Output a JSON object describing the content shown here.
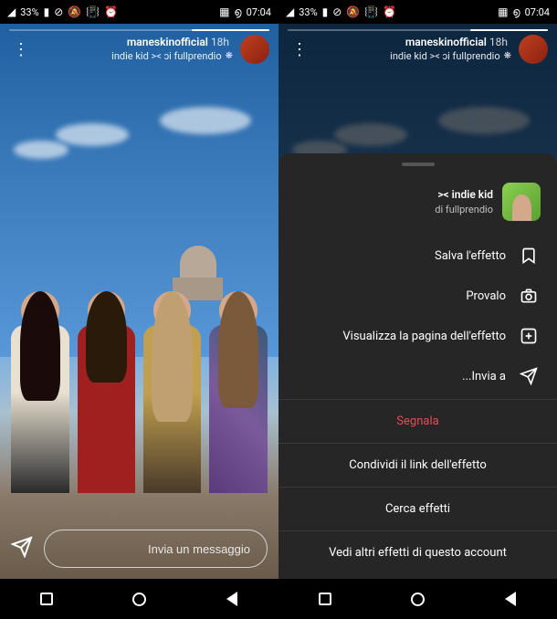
{
  "status": {
    "time": "07:04",
    "battery": "33%",
    "battery_icon": "▮",
    "signal_icon": "◢",
    "wifi_icon": "⊘",
    "alarm_icon": "⏰",
    "vibrate_icon": "📳",
    "dnd_icon": "🔕",
    "app_icon1": "▦",
    "app_icon2": "൭"
  },
  "story": {
    "username": "maneskinofficial",
    "time": "18h",
    "effect_prefix": "❋",
    "effect_text": "indie kid >< ɔi fullprendio",
    "reply_placeholder": "Invia un messaggio"
  },
  "sheet": {
    "effect_name": "indie kid ><",
    "effect_author": "di fullprendio",
    "items": {
      "save": "Salva l'effetto",
      "try": "Provalo",
      "view_page": "Visualizza la pagina dell'effetto",
      "send_to": "Invia a...",
      "report": "Segnala",
      "share_link": "Condividi il link dell'effetto",
      "search": "Cerca effetti",
      "more_from": "Vedi altri effetti di questo account"
    }
  }
}
